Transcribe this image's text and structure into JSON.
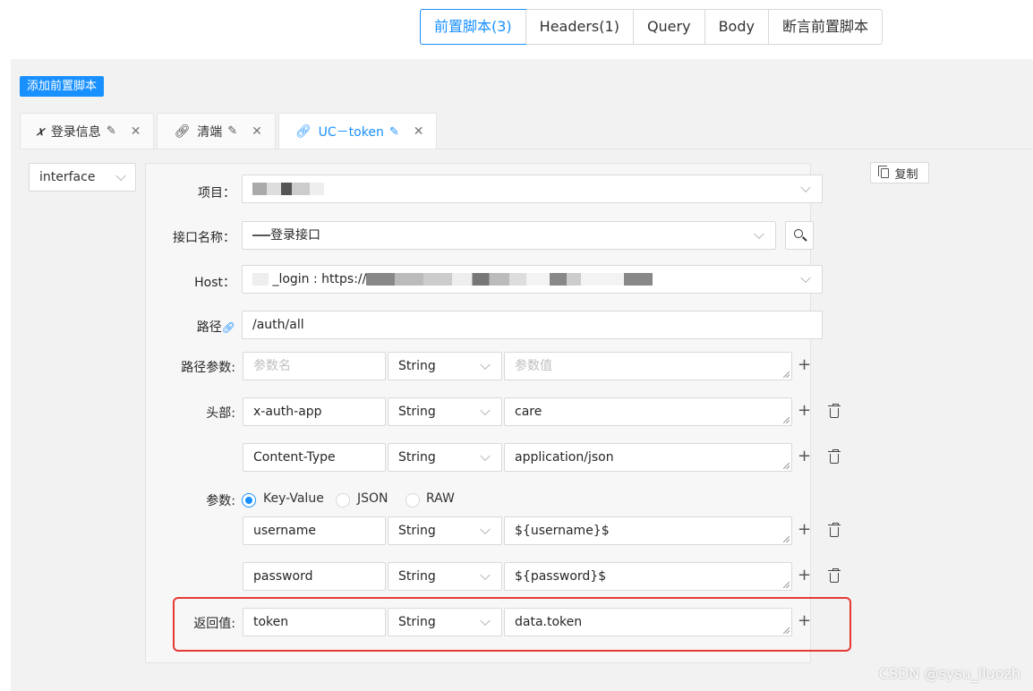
{
  "top_tabs": [
    {
      "label": "前置脚本(3)",
      "active": true
    },
    {
      "label": "Headers(1)",
      "active": false
    },
    {
      "label": "Query",
      "active": false
    },
    {
      "label": "Body",
      "active": false
    },
    {
      "label": "断言前置脚本",
      "active": false
    }
  ],
  "add_button": "添加前置脚本",
  "script_tabs": [
    {
      "icon": "x",
      "label": "登录信息",
      "active": false
    },
    {
      "icon": "link",
      "label": "清端",
      "active": false
    },
    {
      "icon": "link",
      "label": "UC－token",
      "active": true
    }
  ],
  "type_select": "interface",
  "copy_button": "复制",
  "form": {
    "project_label": "项目：",
    "api_label": "接口名称：",
    "api_value": "登录接口",
    "host_label": "Host：",
    "host_value": "_login : https://",
    "path_label": "路径",
    "path_value": "/auth/all",
    "path_params_label": "路径参数:",
    "path_params": {
      "name_placeholder": "参数名",
      "type": "String",
      "value_placeholder": "参数值"
    },
    "headers_label": "头部:",
    "headers": [
      {
        "name": "x-auth-app",
        "type": "String",
        "value": "care"
      },
      {
        "name": "Content-Type",
        "type": "String",
        "value": "application/json"
      }
    ],
    "params_label": "参数:",
    "param_modes": [
      {
        "label": "Key-Value",
        "checked": true
      },
      {
        "label": "JSON",
        "checked": false
      },
      {
        "label": "RAW",
        "checked": false
      }
    ],
    "params": [
      {
        "name": "username",
        "type": "String",
        "value": "${username}$"
      },
      {
        "name": "password",
        "type": "String",
        "value": "${password}$"
      }
    ],
    "return_label": "返回值:",
    "return_row": {
      "name": "token",
      "type": "String",
      "value": "data.token"
    }
  },
  "watermark": "CSDN @sysu_lluozh",
  "colors": {
    "accent": "#1890ff",
    "highlight": "#e53935"
  }
}
